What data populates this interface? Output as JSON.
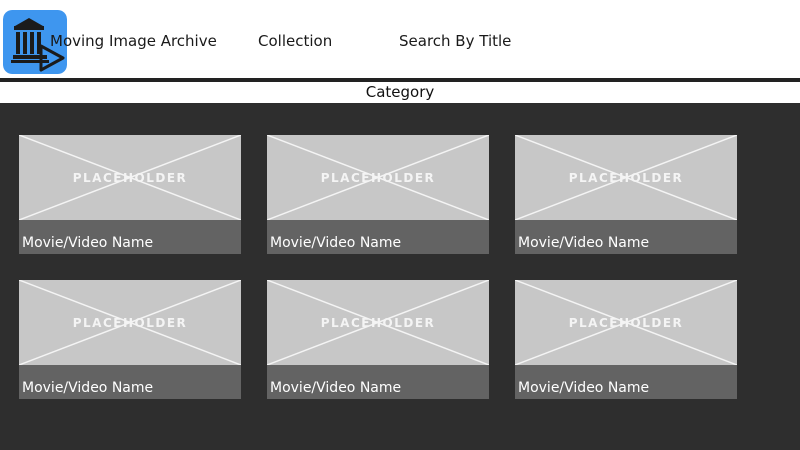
{
  "header": {
    "logo_icon": "archive-building-play-icon",
    "logo_color": "#3e96ef",
    "nav": [
      {
        "label": "Moving Image Archive"
      },
      {
        "label": "Collection"
      },
      {
        "label": "Search By Title"
      }
    ]
  },
  "category": {
    "label": "Category"
  },
  "colors": {
    "content_bg": "#2e2e2e",
    "thumb_bg": "#c7c7c7",
    "caption_bg": "#636363"
  },
  "cards": [
    {
      "thumb_text": "PLACEHOLDER",
      "title": "Movie/Video Name"
    },
    {
      "thumb_text": "PLACEHOLDER",
      "title": "Movie/Video Name"
    },
    {
      "thumb_text": "PLACEHOLDER",
      "title": "Movie/Video Name"
    },
    {
      "thumb_text": "PLACEHOLDER",
      "title": "Movie/Video Name"
    },
    {
      "thumb_text": "PLACEHOLDER",
      "title": "Movie/Video Name"
    },
    {
      "thumb_text": "PLACEHOLDER",
      "title": "Movie/Video Name"
    }
  ]
}
